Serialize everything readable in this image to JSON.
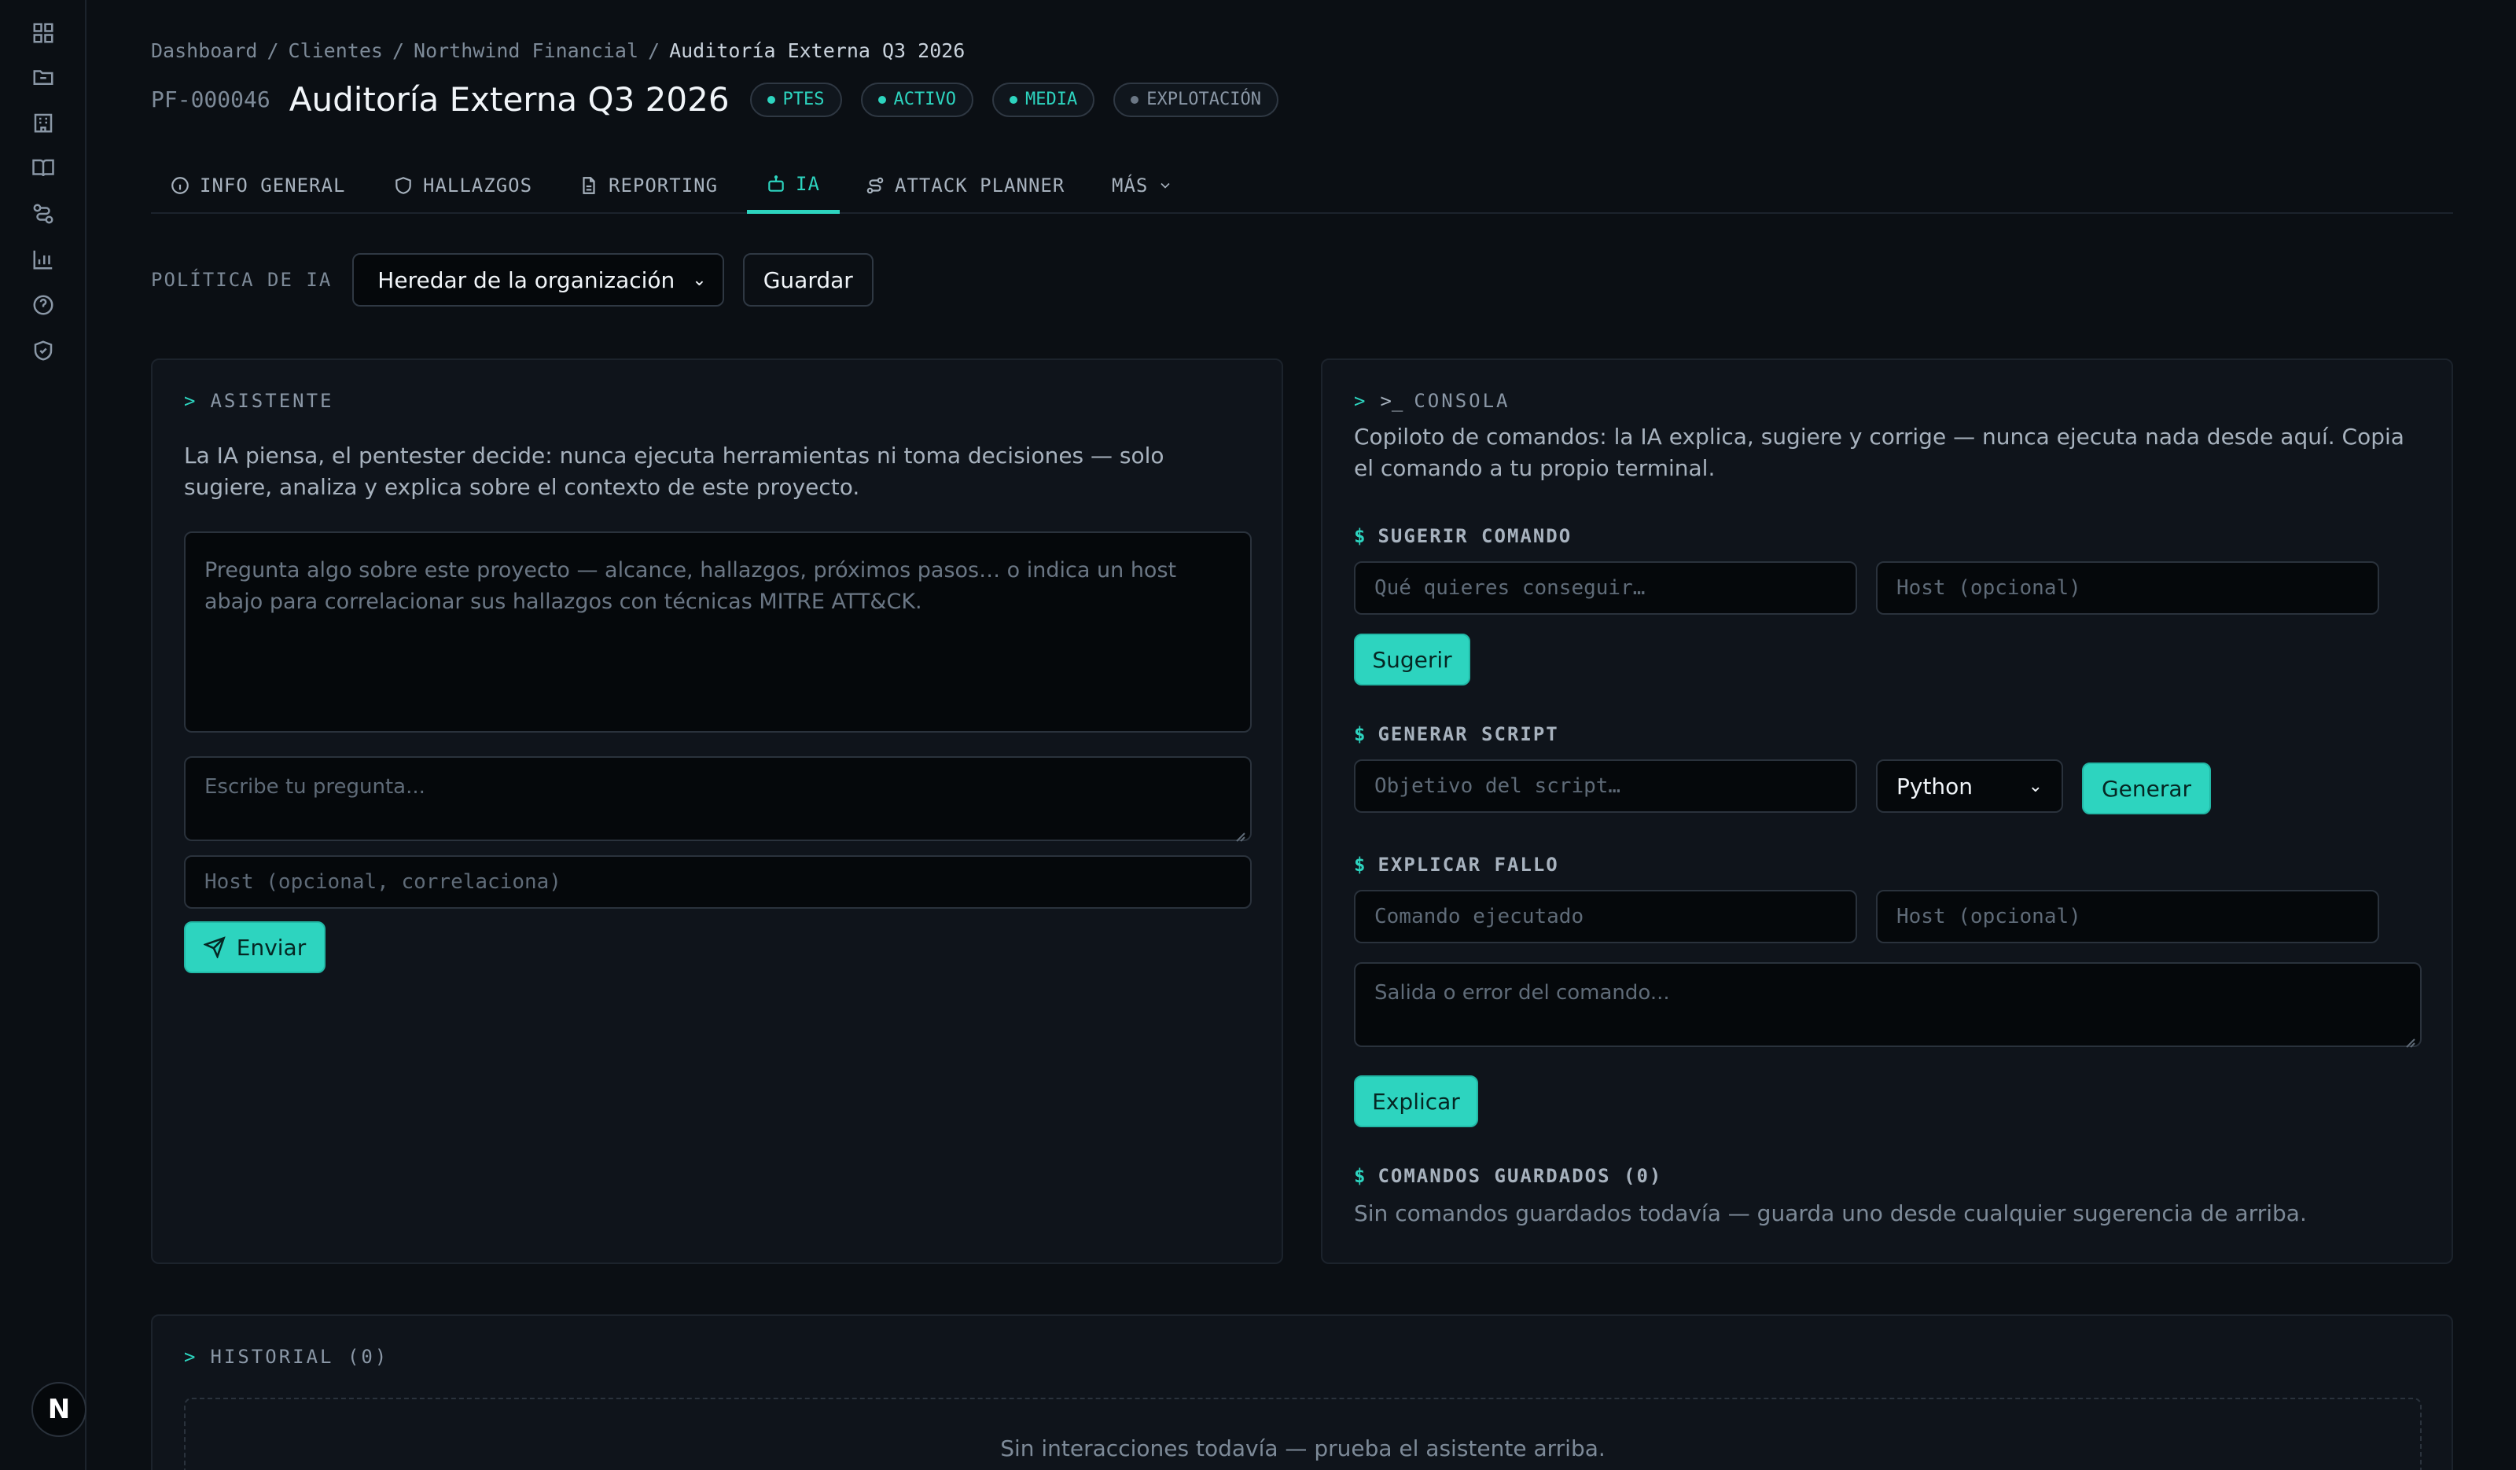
{
  "sidebar": {
    "icons": [
      "dashboard-icon",
      "folder-icon",
      "building-icon",
      "book-icon",
      "workflow-icon",
      "bar-chart-icon",
      "help-icon",
      "shield-check-icon"
    ],
    "avatar_letter": "N"
  },
  "breadcrumb": {
    "items": [
      "Dashboard",
      "Clientes",
      "Northwind Financial"
    ],
    "current": "Auditoría Externa Q3 2026"
  },
  "project": {
    "id": "PF-000046",
    "title": "Auditoría Externa Q3 2026",
    "badges": [
      "PTES",
      "ACTIVO",
      "MEDIA",
      "EXPLOTACIÓN"
    ]
  },
  "tabs": [
    {
      "label": "INFO GENERAL",
      "icon": "info-icon"
    },
    {
      "label": "HALLAZGOS",
      "icon": "shield-icon"
    },
    {
      "label": "REPORTING",
      "icon": "file-icon"
    },
    {
      "label": "IA",
      "icon": "robot-icon",
      "active": true
    },
    {
      "label": "ATTACK PLANNER",
      "icon": "route-icon"
    },
    {
      "label": "MÁS",
      "icon": "chevron-down-icon"
    }
  ],
  "policy": {
    "label": "POLÍTICA DE IA",
    "selected": "Heredar de la organización",
    "save_label": "Guardar"
  },
  "assistant": {
    "header": "ASISTENTE",
    "description": "La IA piensa, el pentester decide: nunca ejecuta herramientas ni toma decisiones — solo sugiere, analiza y explica sobre el contexto de este proyecto.",
    "conversation_placeholder": "Pregunta algo sobre este proyecto — alcance, hallazgos, próximos pasos… o indica un host abajo para correlacionar sus hallazgos con técnicas MITRE ATT&CK.",
    "question_placeholder": "Escribe tu pregunta...",
    "host_placeholder": "Host (opcional, correlaciona)",
    "send_label": "Enviar"
  },
  "console": {
    "header": "CONSOLA",
    "description": "Copiloto de comandos: la IA explica, sugiere y corrige — nunca ejecuta nada desde aquí. Copia el comando a tu propio terminal.",
    "suggest": {
      "label": "SUGERIR COMANDO",
      "goal_placeholder": "Qué quieres conseguir…",
      "host_placeholder": "Host (opcional)",
      "button": "Sugerir"
    },
    "script": {
      "label": "GENERAR SCRIPT",
      "goal_placeholder": "Objetivo del script…",
      "language": "Python",
      "button": "Generar"
    },
    "explain": {
      "label": "EXPLICAR FALLO",
      "command_placeholder": "Comando ejecutado",
      "host_placeholder": "Host (opcional)",
      "output_placeholder": "Salida o error del comando...",
      "button": "Explicar"
    },
    "saved": {
      "label": "COMANDOS GUARDADOS (0)",
      "empty": "Sin comandos guardados todavía — guarda uno desde cualquier sugerencia de arriba."
    }
  },
  "history": {
    "header": "HISTORIAL (0)",
    "empty": "Sin interacciones todavía — prueba el asistente arriba."
  },
  "colors": {
    "accent": "#2dd4bf",
    "background": "#0b0f14",
    "panel": "#0f141b"
  }
}
